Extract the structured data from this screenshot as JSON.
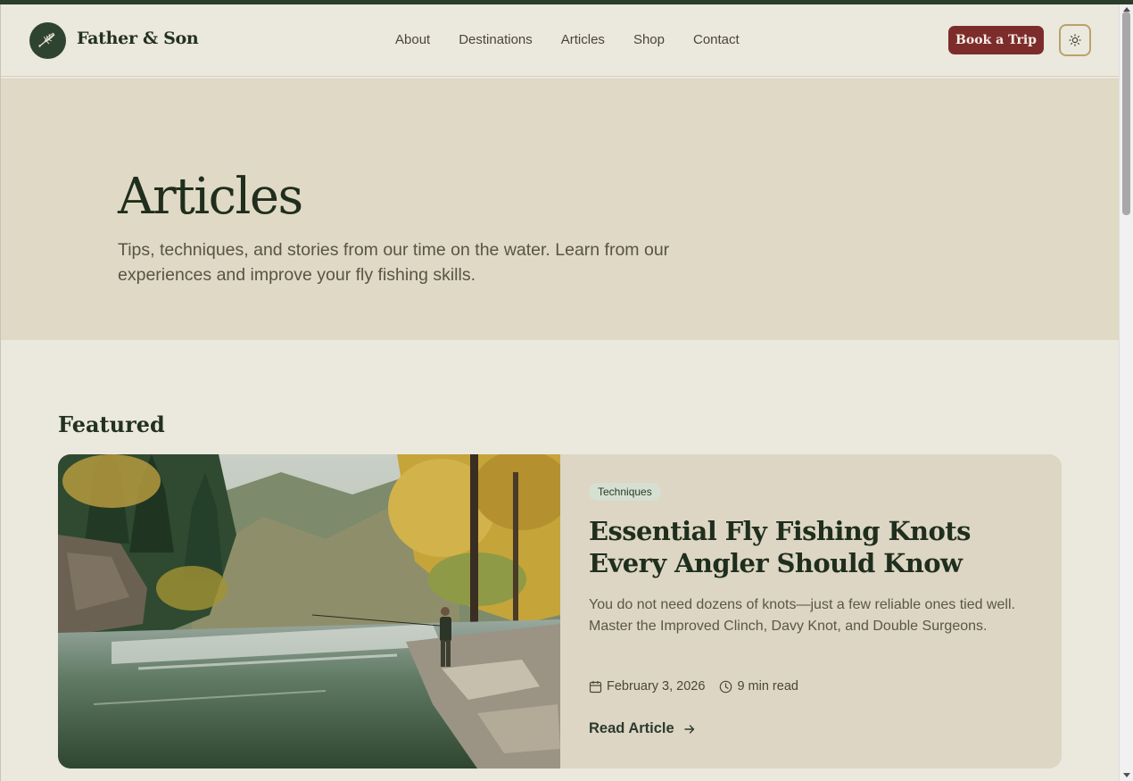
{
  "brand": {
    "name": "Father & Son",
    "logo_icon": "fly-lure-icon"
  },
  "nav": {
    "items": [
      {
        "label": "About"
      },
      {
        "label": "Destinations"
      },
      {
        "label": "Articles"
      },
      {
        "label": "Shop"
      },
      {
        "label": "Contact"
      }
    ]
  },
  "header": {
    "cta_label": "Book a Trip",
    "theme_toggle_icon": "sun-icon"
  },
  "hero": {
    "title": "Articles",
    "subtitle": "Tips, techniques, and stories from our time on the water. Learn from our experiences and improve your fly fishing skills."
  },
  "featured": {
    "section_label": "Featured",
    "category": "Techniques",
    "title": "Essential Fly Fishing Knots Every Angler Should Know",
    "excerpt": "You do not need dozens of knots—just a few reliable ones tied well. Master the Improved Clinch, Davy Knot, and Double Surgeons.",
    "date": "February 3, 2026",
    "read_time": "9 min read",
    "read_label": "Read Article",
    "image_icon": "river-landscape-painting"
  },
  "colors": {
    "primary_dark_green": "#2e4330",
    "cta_red": "#7d2c2c",
    "page_bg": "#ebe8dd",
    "hero_bg": "#e0d9c5",
    "badge_bg": "#d5e0d2"
  }
}
